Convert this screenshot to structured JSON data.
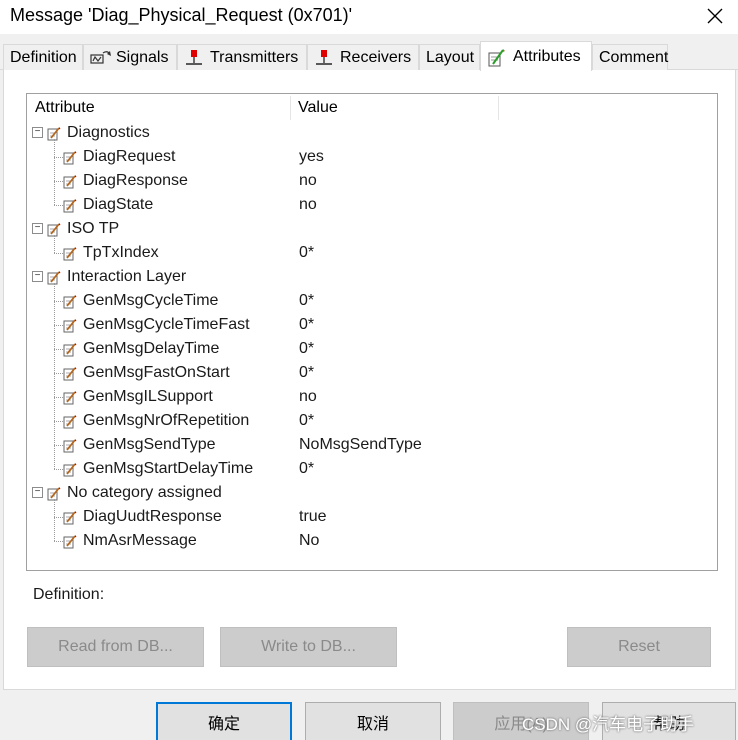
{
  "window": {
    "title": "Message 'Diag_Physical_Request (0x701)'"
  },
  "tabs": [
    {
      "label": "Definition",
      "icon": "none"
    },
    {
      "label": "Signals",
      "icon": "signals-icon"
    },
    {
      "label": "Transmitters",
      "icon": "transmitter-icon"
    },
    {
      "label": "Receivers",
      "icon": "receiver-icon"
    },
    {
      "label": "Layout",
      "icon": "none"
    },
    {
      "label": "Attributes",
      "icon": "attributes-icon",
      "active": true
    },
    {
      "label": "Comment",
      "icon": "none"
    }
  ],
  "grid": {
    "columns": [
      "Attribute",
      "Value"
    ],
    "groups": [
      {
        "name": "Diagnostics",
        "expanded": true,
        "items": [
          {
            "name": "DiagRequest",
            "value": "yes"
          },
          {
            "name": "DiagResponse",
            "value": "no"
          },
          {
            "name": "DiagState",
            "value": "no"
          }
        ]
      },
      {
        "name": "ISO TP",
        "expanded": true,
        "items": [
          {
            "name": "TpTxIndex",
            "value": "0*"
          }
        ]
      },
      {
        "name": "Interaction Layer",
        "expanded": true,
        "items": [
          {
            "name": "GenMsgCycleTime",
            "value": "0*"
          },
          {
            "name": "GenMsgCycleTimeFast",
            "value": "0*"
          },
          {
            "name": "GenMsgDelayTime",
            "value": "0*"
          },
          {
            "name": "GenMsgFastOnStart",
            "value": "0*"
          },
          {
            "name": "GenMsgILSupport",
            "value": "no"
          },
          {
            "name": "GenMsgNrOfRepetition",
            "value": "0*"
          },
          {
            "name": "GenMsgSendType",
            "value": "NoMsgSendType"
          },
          {
            "name": "GenMsgStartDelayTime",
            "value": "0*"
          }
        ]
      },
      {
        "name": "No category assigned",
        "expanded": true,
        "items": [
          {
            "name": "DiagUudtResponse",
            "value": "true"
          },
          {
            "name": "NmAsrMessage",
            "value": "No"
          }
        ]
      }
    ]
  },
  "definition": {
    "label": "Definition:"
  },
  "buttons": {
    "read_from_db": "Read from DB...",
    "write_to_db": "Write to DB...",
    "reset": "Reset"
  },
  "footer": {
    "ok": "确定",
    "cancel": "取消",
    "apply": "应用(A)",
    "help": "帮助"
  },
  "watermark": "CSDN @汽车电子助手",
  "colors": {
    "accent": "#0078d7",
    "icon_red": "#e00000",
    "icon_green": "#2a9d2a",
    "icon_brown": "#b5651d"
  }
}
